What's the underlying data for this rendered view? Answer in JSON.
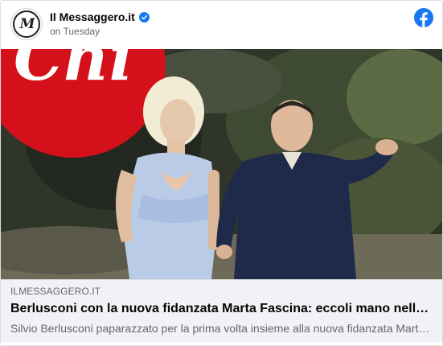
{
  "post": {
    "page_name": "Il Messaggero.it",
    "avatar_monogram": "M",
    "timestamp": "on Tuesday",
    "verified": true
  },
  "photo": {
    "magazine_logo_text": "Chi",
    "magazine_logo_color": "#d4111a"
  },
  "link_preview": {
    "domain": "ILMESSAGGERO.IT",
    "headline": "Berlusconi con la nuova fidanzata Marta Fascina: eccoli mano nella mano",
    "description": "Silvio Berlusconi paparazzato per la prima volta insieme alla nuova fidanzata Marta Fascina"
  },
  "icons": {
    "verified": "verified-badge-icon",
    "facebook": "facebook-logo-icon"
  },
  "colors": {
    "facebook_blue": "#1877f2",
    "secondary_text": "#65676b",
    "footer_bg": "#f0f2f5"
  }
}
